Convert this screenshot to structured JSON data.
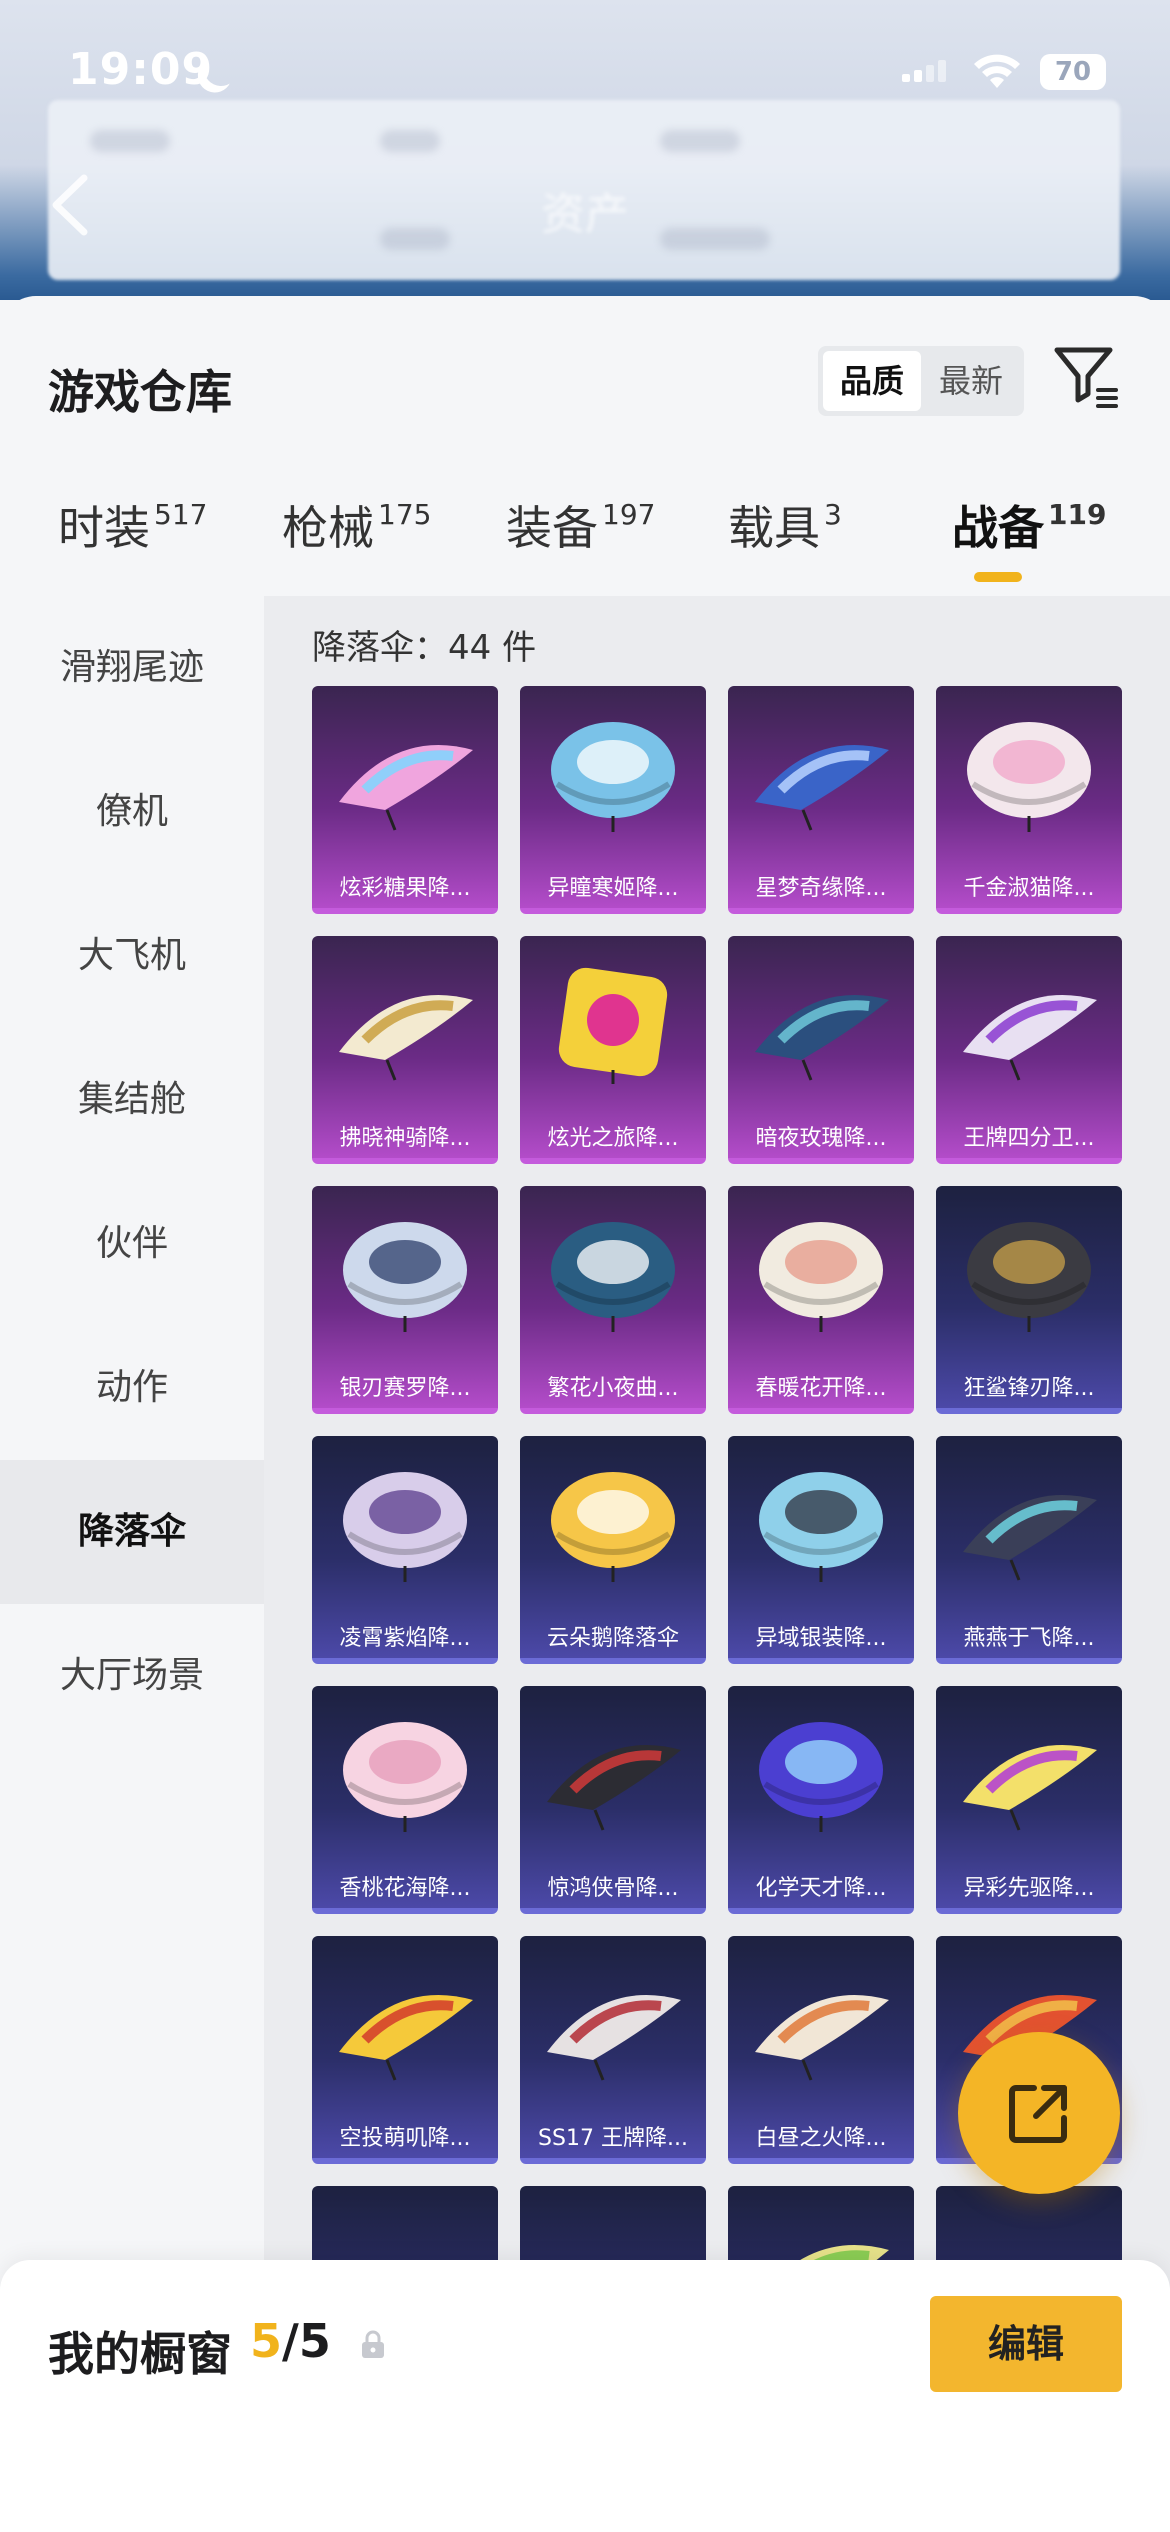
{
  "status_bar": {
    "time": "19:09",
    "battery": "70"
  },
  "header": {
    "title": "资产"
  },
  "panel": {
    "title": "游戏仓库",
    "sort": {
      "options": [
        "品质",
        "最新"
      ],
      "selected": "品质"
    }
  },
  "tabs": [
    {
      "label": "时装",
      "count": "517"
    },
    {
      "label": "枪械",
      "count": "175"
    },
    {
      "label": "装备",
      "count": "197"
    },
    {
      "label": "载具",
      "count": "3"
    },
    {
      "label": "战备",
      "count": "119"
    }
  ],
  "active_tab": "战备",
  "sidebar": {
    "items": [
      "滑翔尾迹",
      "僚机",
      "大飞机",
      "集结舱",
      "伙伴",
      "动作",
      "降落伞",
      "大厅场景"
    ],
    "selected": "降落伞"
  },
  "content": {
    "count_label": "降落伞：44 件",
    "items": [
      {
        "name": "炫彩糖果降...",
        "rarity": "purple",
        "shape": "wing",
        "color": "#f0a5de",
        "accent": "#7fd6ff"
      },
      {
        "name": "异瞳寒姬降...",
        "rarity": "purple",
        "shape": "dome",
        "color": "#7ac2e8",
        "accent": "#ffffff"
      },
      {
        "name": "星梦奇缘降...",
        "rarity": "purple",
        "shape": "wing",
        "color": "#3a64c8",
        "accent": "#b9d2ff"
      },
      {
        "name": "千金淑猫降...",
        "rarity": "purple",
        "shape": "dome",
        "color": "#f3e7ec",
        "accent": "#f2a6c9"
      },
      {
        "name": "拂晓神骑降...",
        "rarity": "purple",
        "shape": "wing",
        "color": "#f3ead0",
        "accent": "#c9a040"
      },
      {
        "name": "炫光之旅降...",
        "rarity": "purple",
        "shape": "square",
        "color": "#f4d03a",
        "accent": "#e0348f"
      },
      {
        "name": "暗夜玫瑰降...",
        "rarity": "purple",
        "shape": "wing",
        "color": "#2b4f7e",
        "accent": "#6fc7d8"
      },
      {
        "name": "王牌四分卫...",
        "rarity": "purple",
        "shape": "wing",
        "color": "#e8e0f2",
        "accent": "#8a3ad0"
      },
      {
        "name": "银刃赛罗降...",
        "rarity": "purple",
        "shape": "dome",
        "color": "#cdd9ec",
        "accent": "#2c3d6b"
      },
      {
        "name": "繁花小夜曲...",
        "rarity": "purple",
        "shape": "dome",
        "color": "#2a5d82",
        "accent": "#ffffff"
      },
      {
        "name": "春暖花开降...",
        "rarity": "purple",
        "shape": "dome",
        "color": "#f1ebe0",
        "accent": "#e59a8a"
      },
      {
        "name": "狂鲨锋刃降...",
        "rarity": "blue",
        "shape": "dome",
        "color": "#3b3b42",
        "accent": "#c9a24a"
      },
      {
        "name": "凌霄紫焰降...",
        "rarity": "blue",
        "shape": "dome",
        "color": "#d8cdea",
        "accent": "#5b3c8c"
      },
      {
        "name": "云朵鹅降落伞",
        "rarity": "blue",
        "shape": "dome",
        "color": "#f6c648",
        "accent": "#ffffff"
      },
      {
        "name": "异域银装降...",
        "rarity": "blue",
        "shape": "dome",
        "color": "#8fd0ea",
        "accent": "#2f3340"
      },
      {
        "name": "燕燕于飞降...",
        "rarity": "blue",
        "shape": "wing",
        "color": "#3a3f58",
        "accent": "#6fd3e0"
      },
      {
        "name": "香桃花海降...",
        "rarity": "blue",
        "shape": "dome",
        "color": "#f7d4e2",
        "accent": "#e59bb8"
      },
      {
        "name": "惊鸿侠骨降...",
        "rarity": "blue",
        "shape": "wing",
        "color": "#2c2c33",
        "accent": "#d13a3a"
      },
      {
        "name": "化学天才降...",
        "rarity": "blue",
        "shape": "dome",
        "color": "#4b3fd1",
        "accent": "#9be0ff"
      },
      {
        "name": "异彩先驱降...",
        "rarity": "blue",
        "shape": "wing",
        "color": "#f3e06a",
        "accent": "#b03ad6"
      },
      {
        "name": "空投萌叽降...",
        "rarity": "blue",
        "shape": "wing",
        "color": "#f5c93a",
        "accent": "#d23b2b"
      },
      {
        "name": "SS17 王牌降...",
        "rarity": "blue",
        "shape": "wing",
        "color": "#e6e1e2",
        "accent": "#b22a34"
      },
      {
        "name": "白昼之火降...",
        "rarity": "blue",
        "shape": "wing",
        "color": "#f1e6d6",
        "accent": "#e0793a"
      },
      {
        "name": "",
        "rarity": "blue",
        "shape": "wing",
        "color": "#e35230",
        "accent": "#f2c14a"
      },
      {
        "name": "",
        "rarity": "blue",
        "shape": "none",
        "color": "#2f3270",
        "accent": "#2f3270"
      },
      {
        "name": "",
        "rarity": "blue",
        "shape": "none",
        "color": "#2f3270",
        "accent": "#2f3270"
      },
      {
        "name": "",
        "rarity": "blue",
        "shape": "wing",
        "color": "#e7e28a",
        "accent": "#7ac94a"
      },
      {
        "name": "",
        "rarity": "blue",
        "shape": "none",
        "color": "#2f3270",
        "accent": "#2f3270"
      }
    ]
  },
  "window": {
    "label": "我的橱窗",
    "current": "5",
    "total": "/5"
  },
  "edit_button": "编辑",
  "colors": {
    "accent": "#f3b62e",
    "purple_rarity": "#c45bdc",
    "blue_rarity": "#6b6bd6"
  }
}
